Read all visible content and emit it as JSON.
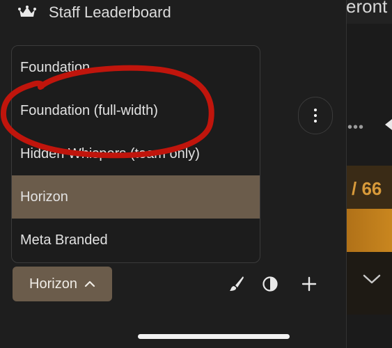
{
  "panel": {
    "title": "Staff Leaderboard",
    "title_icon": "crown-icon"
  },
  "theme_menu": {
    "items": [
      {
        "label": "Foundation",
        "selected": false
      },
      {
        "label": "Foundation (full-width)",
        "selected": false
      },
      {
        "label": "Hidden Whispers (team only)",
        "selected": false
      },
      {
        "label": "Horizon",
        "selected": true
      },
      {
        "label": "Meta Branded",
        "selected": false
      }
    ]
  },
  "theme_button": {
    "label": "Horizon",
    "icon": "chevron-up-icon"
  },
  "toolbar": {
    "icons": [
      "paintbrush-icon",
      "contrast-icon",
      "plus-icon"
    ]
  },
  "background": {
    "top_text": "eront",
    "score_text": "/ 66"
  },
  "colors": {
    "panel_bg": "#1e1e1e",
    "selected_bg": "#6b5c4b",
    "annotation": "#c0150c",
    "accent_orange": "#c9861f"
  }
}
